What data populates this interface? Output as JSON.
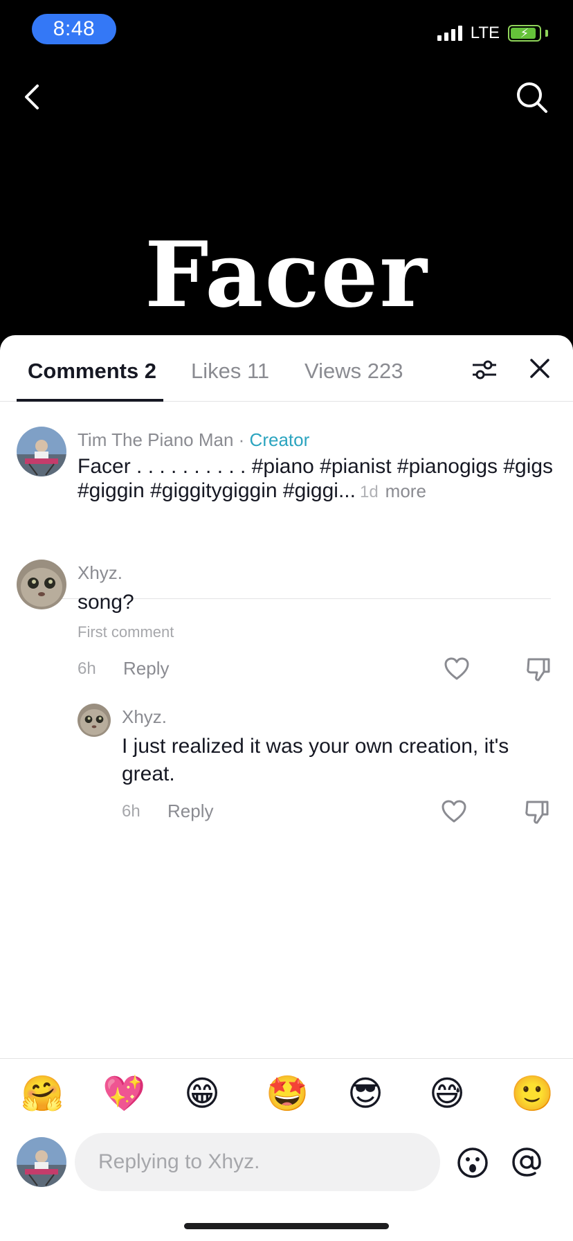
{
  "status_bar": {
    "time": "8:48",
    "network": "LTE"
  },
  "video": {
    "title": "Facer"
  },
  "tabs": [
    {
      "label": "Comments 2",
      "active": true
    },
    {
      "label": "Likes 11",
      "active": false
    },
    {
      "label": "Views 223",
      "active": false
    }
  ],
  "caption": {
    "author": "Tim The Piano Man",
    "separator": " · ",
    "badge": "Creator",
    "text": "Facer . . . . . . . . . . #piano #pianist #pianogigs #gigs #giggin #giggitygiggin #giggi...",
    "time": "1d",
    "more_label": "more"
  },
  "comments": [
    {
      "username": "Xhyz.",
      "text": "song?",
      "tag": "First comment",
      "time": "6h",
      "reply_label": "Reply"
    }
  ],
  "replies": [
    {
      "username": "Xhyz.",
      "text": "I just realized it was your own creation, it's great.",
      "time": "6h",
      "reply_label": "Reply"
    }
  ],
  "emojis": [
    "🤗",
    "💖",
    "😁",
    "🤩",
    "😎",
    "😅",
    "🙂"
  ],
  "reply_input": {
    "placeholder": "Replying to Xhyz."
  },
  "colors": {
    "creator_badge": "#2ba4bf",
    "time_pill": "#3478f6",
    "battery": "#65c23a"
  }
}
